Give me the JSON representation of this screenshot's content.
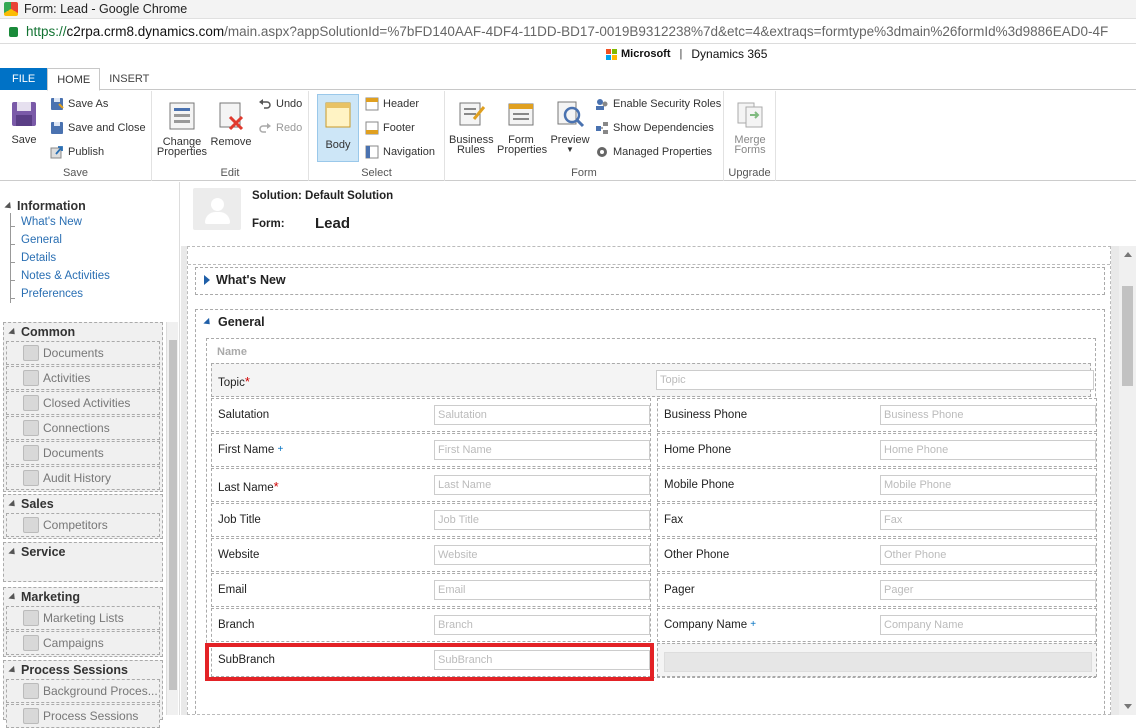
{
  "browser": {
    "title": "Form: Lead - Google Chrome",
    "url_scheme": "https://",
    "url_host": "c2rpa.crm8.dynamics.com",
    "url_path": "/main.aspx?appSolutionId=%7bFD140AAF-4DF4-11DD-BD17-0019B9312238%7d&etc=4&extraqs=formtype%3dmain%26formId%3d9886EAD0-4F"
  },
  "brand": {
    "microsoft": "Microsoft",
    "separator": "|",
    "product": "Dynamics 365"
  },
  "tabs": [
    {
      "label": "FILE"
    },
    {
      "label": "HOME"
    },
    {
      "label": "INSERT"
    }
  ],
  "ribbon": {
    "save": {
      "label": "Save",
      "save_as": "Save As",
      "save_close": "Save and Close",
      "publish": "Publish",
      "group": "Save"
    },
    "edit": {
      "change_properties_1": "Change",
      "change_properties_2": "Properties",
      "remove": "Remove",
      "undo": "Undo",
      "redo": "Redo",
      "group": "Edit"
    },
    "select": {
      "body": "Body",
      "header": "Header",
      "footer": "Footer",
      "navigation": "Navigation",
      "group": "Select"
    },
    "form": {
      "business_rules_1": "Business",
      "business_rules_2": "Rules",
      "form_properties_1": "Form",
      "form_properties_2": "Properties",
      "preview": "Preview",
      "enable_security": "Enable Security Roles",
      "show_dependencies": "Show Dependencies",
      "managed_properties": "Managed Properties",
      "group": "Form"
    },
    "upgrade": {
      "merge_forms_1": "Merge",
      "merge_forms_2": "Forms",
      "group": "Upgrade"
    }
  },
  "nav": {
    "information": {
      "title": "Information",
      "links": [
        "What's New",
        "General",
        "Details",
        "Notes & Activities",
        "Preferences"
      ]
    },
    "common": {
      "title": "Common",
      "items": [
        "Documents",
        "Activities",
        "Closed Activities",
        "Connections",
        "Documents",
        "Audit History"
      ]
    },
    "sales": {
      "title": "Sales",
      "items": [
        "Competitors"
      ]
    },
    "service": {
      "title": "Service"
    },
    "marketing": {
      "title": "Marketing",
      "items": [
        "Marketing Lists",
        "Campaigns"
      ]
    },
    "process": {
      "title": "Process Sessions",
      "items": [
        "Background Proces...",
        "Process Sessions"
      ]
    }
  },
  "header": {
    "solution": "Solution: Default Solution",
    "form_label": "Form:",
    "form_value": "Lead"
  },
  "sections": {
    "whats_new": "What's New",
    "general": "General",
    "name_subheader": "Name"
  },
  "fields": {
    "topic": {
      "label": "Topic",
      "placeholder": "Topic"
    },
    "left": [
      {
        "label": "Salutation",
        "placeholder": "Salutation"
      },
      {
        "label": "First Name",
        "placeholder": "First Name"
      },
      {
        "label": "Last Name",
        "placeholder": "Last Name"
      },
      {
        "label": "Job Title",
        "placeholder": "Job Title"
      },
      {
        "label": "Website",
        "placeholder": "Website"
      },
      {
        "label": "Email",
        "placeholder": "Email"
      },
      {
        "label": "Branch",
        "placeholder": "Branch"
      },
      {
        "label": "SubBranch",
        "placeholder": "SubBranch"
      }
    ],
    "right": [
      {
        "label": "Business Phone",
        "placeholder": "Business Phone"
      },
      {
        "label": "Home Phone",
        "placeholder": "Home Phone"
      },
      {
        "label": "Mobile Phone",
        "placeholder": "Mobile Phone"
      },
      {
        "label": "Fax",
        "placeholder": "Fax"
      },
      {
        "label": "Other Phone",
        "placeholder": "Other Phone"
      },
      {
        "label": "Pager",
        "placeholder": "Pager"
      },
      {
        "label": "Company Name",
        "placeholder": "Company Name"
      }
    ],
    "required_mark": "*",
    "recommended_mark": "+"
  },
  "colors": {
    "file_tab": "#0072c6",
    "highlight": "#e32226",
    "link": "#2a6fb3"
  }
}
